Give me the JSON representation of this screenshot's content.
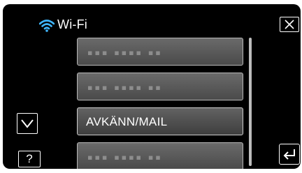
{
  "header": {
    "title": "Wi-Fi",
    "icon": "wifi-icon",
    "accent_color": "#3fb6ff"
  },
  "list": {
    "items": [
      {
        "label": "",
        "placeholder": "▪▪▪ ▪▪▪▪ ▪▪",
        "highlighted": false
      },
      {
        "label": "",
        "placeholder": "▪▪▪ ▪▪▪▪ ▪▪",
        "highlighted": false
      },
      {
        "label": "AVKÄNN/MAIL",
        "placeholder": "",
        "highlighted": true
      },
      {
        "label": "",
        "placeholder": "▪▪▪ ▪▪▪▪ ▪▪",
        "highlighted": false
      }
    ]
  },
  "controls": {
    "close_icon": "close-icon",
    "down_icon": "chevron-down-icon",
    "help_label": "?",
    "back_icon": "back-arrow-icon"
  }
}
